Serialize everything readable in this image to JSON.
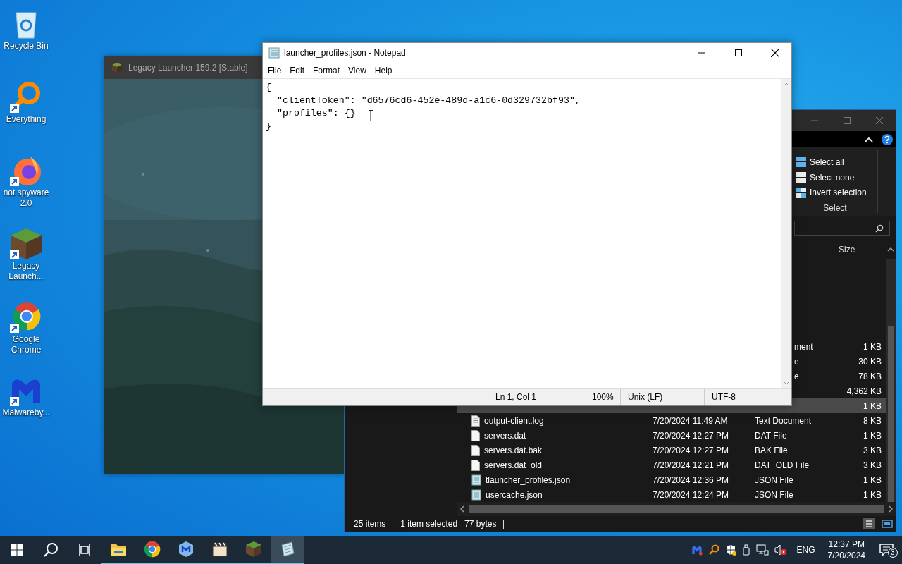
{
  "desktop_icons": [
    {
      "kind": "recycle-bin",
      "label": "Recycle Bin",
      "shortcut": false
    },
    {
      "kind": "everything",
      "label": "Everything",
      "shortcut": true
    },
    {
      "kind": "firefox",
      "label": "not spyware 2.0",
      "shortcut": true
    },
    {
      "kind": "grass-block",
      "label": "Legacy Launch...",
      "shortcut": true
    },
    {
      "kind": "chrome",
      "label": "Google Chrome",
      "shortcut": true
    },
    {
      "kind": "malwarebytes",
      "label": "Malwareby...",
      "shortcut": true
    }
  ],
  "launcher_window": {
    "title": "Legacy Launcher 159.2 [Stable]"
  },
  "explorer_window": {
    "select_group": {
      "title": "Select",
      "actions": [
        {
          "kind": "select-all",
          "label": "Select all"
        },
        {
          "kind": "select-none",
          "label": "Select none"
        },
        {
          "kind": "invert",
          "label": "Invert selection"
        }
      ]
    },
    "columns": [
      "Size"
    ],
    "rows": [
      {
        "kind": "partial",
        "type": "ment",
        "size": "1 KB",
        "selected": false
      },
      {
        "kind": "partial",
        "type": "e",
        "size": "30 KB",
        "selected": false
      },
      {
        "kind": "partial",
        "type": "e",
        "size": "78 KB",
        "selected": false
      },
      {
        "kind": "partial",
        "size": "4,362 KB",
        "selected": false
      },
      {
        "kind": "partial",
        "size": "1 KB",
        "selected": true
      },
      {
        "kind": "text-file",
        "name": "output-client.log",
        "date": "7/20/2024 11:49 AM",
        "type": "Text Document",
        "size": "8 KB",
        "selected": false
      },
      {
        "kind": "file",
        "name": "servers.dat",
        "date": "7/20/2024 12:27 PM",
        "type": "DAT File",
        "size": "1 KB",
        "selected": false
      },
      {
        "kind": "file",
        "name": "servers.dat.bak",
        "date": "7/20/2024 12:27 PM",
        "type": "BAK File",
        "size": "3 KB",
        "selected": false
      },
      {
        "kind": "file",
        "name": "servers.dat_old",
        "date": "7/20/2024 12:21 PM",
        "type": "DAT_OLD File",
        "size": "3 KB",
        "selected": false
      },
      {
        "kind": "json-file",
        "name": "tlauncher_profiles.json",
        "date": "7/20/2024 12:36 PM",
        "type": "JSON File",
        "size": "1 KB",
        "selected": false
      },
      {
        "kind": "json-file",
        "name": "usercache.json",
        "date": "7/20/2024 12:24 PM",
        "type": "JSON File",
        "size": "1 KB",
        "selected": false
      }
    ],
    "status": {
      "items": "25 items",
      "selection": "1 item selected",
      "bytes": "77 bytes"
    }
  },
  "notepad": {
    "title": "launcher_profiles.json - Notepad",
    "menu": [
      "File",
      "Edit",
      "Format",
      "View",
      "Help"
    ],
    "lines": [
      "{",
      "  \"clientToken\": \"d6576cd6-452e-489d-a1c6-0d329732bf93\",",
      "  \"profiles\": {}",
      "}"
    ],
    "status": [
      "Ln 1, Col 1",
      "100%",
      "Unix (LF)",
      "UTF-8"
    ]
  },
  "taskbar": {
    "apps": [
      {
        "kind": "explorer",
        "selected": false
      },
      {
        "kind": "chrome",
        "selected": false
      },
      {
        "kind": "malwarebytes",
        "selected": false
      },
      {
        "kind": "media-player",
        "selected": false
      },
      {
        "kind": "grass-block",
        "selected": false
      },
      {
        "kind": "notepad",
        "selected": true
      }
    ],
    "tray": [
      {
        "kind": "malwarebytes"
      },
      {
        "kind": "everything"
      },
      {
        "kind": "shield"
      },
      {
        "kind": "usb"
      },
      {
        "kind": "network"
      },
      {
        "kind": "volume-muted"
      }
    ],
    "language": "ENG",
    "time": "12:37 PM",
    "date": "7/20/2024",
    "notifications": "3"
  }
}
